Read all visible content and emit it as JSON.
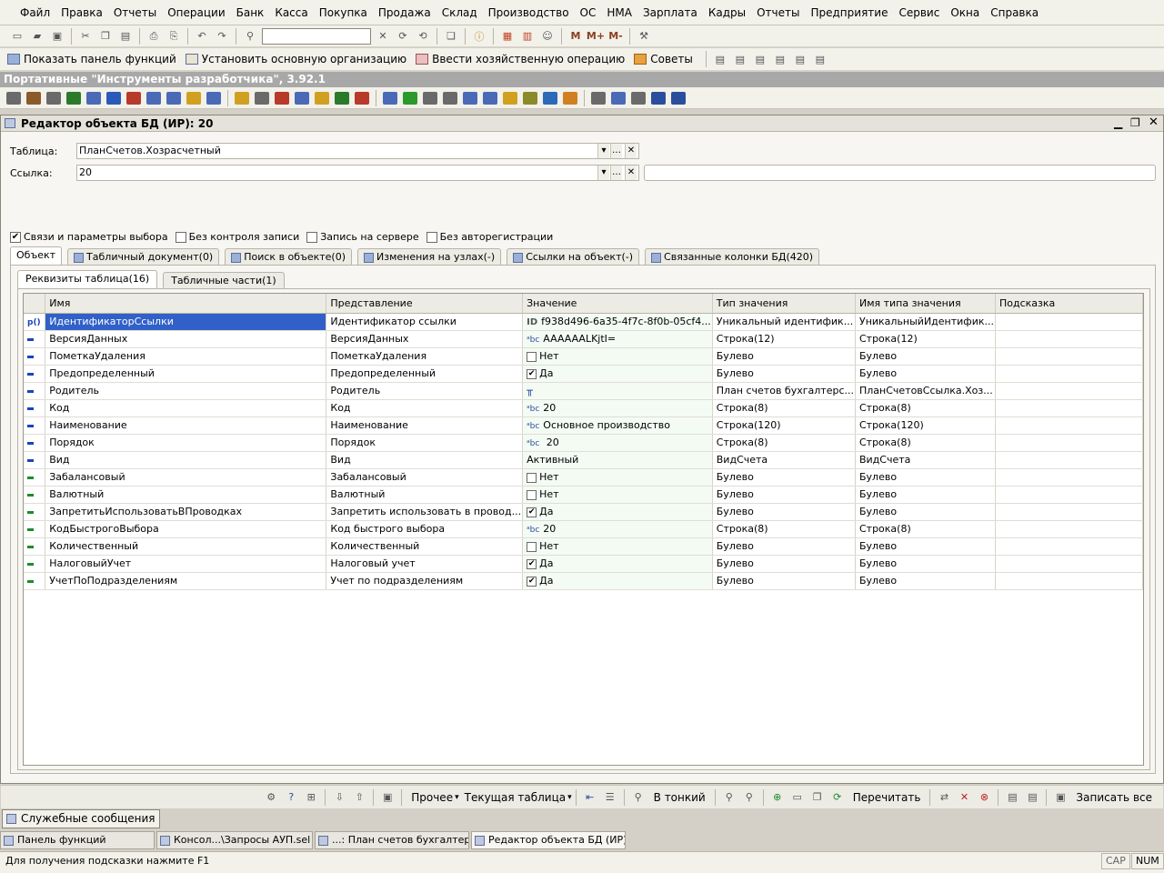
{
  "menu": [
    "Файл",
    "Правка",
    "Отчеты",
    "Операции",
    "Банк",
    "Касса",
    "Покупка",
    "Продажа",
    "Склад",
    "Производство",
    "ОС",
    "НМА",
    "Зарплата",
    "Кадры",
    "Отчеты",
    "Предприятие",
    "Сервис",
    "Окна",
    "Справка"
  ],
  "toolbar2": {
    "show_panel": "Показать панель функций",
    "set_org": "Установить основную организацию",
    "enter_op": "Ввести хозяйственную операцию",
    "tips": "Советы"
  },
  "portable_bar": "Портативные \"Инструменты разработчика\", 3.92.1",
  "window": {
    "title": "Редактор объекта БД (ИР): 20",
    "table_label": "Таблица:",
    "table_value": "ПланСчетов.Хозрасчетный",
    "link_label": "Ссылка:",
    "link_value": "20",
    "checks": [
      {
        "label": "Связи и параметры выбора",
        "checked": true
      },
      {
        "label": "Без контроля записи",
        "checked": false
      },
      {
        "label": "Запись на сервере",
        "checked": false
      },
      {
        "label": "Без авторегистрации",
        "checked": false
      }
    ],
    "tabs": [
      "Объект",
      "Табличный документ(0)",
      "Поиск в объекте(0)",
      "Изменения на узлах(-)",
      "Ссылки на объект(-)",
      "Связанные колонки БД(420)"
    ],
    "subtabs": [
      "Реквизиты таблица(16)",
      "Табличные части(1)"
    ]
  },
  "grid": {
    "columns": [
      "Имя",
      "Представление",
      "Значение",
      "Тип значения",
      "Имя типа значения",
      "Подсказка"
    ],
    "rows": [
      {
        "mark": "p()",
        "name": "ИдентификаторСсылки",
        "pres": "Идентификатор ссылки",
        "icon": "ID",
        "value": "f938d496-6a35-4f7c-8f0b-05cf4...",
        "type": "Уникальный идентифик...",
        "tname": "УникальныйИдентифик...",
        "hint": ""
      },
      {
        "mark": "blue",
        "name": "ВерсияДанных",
        "pres": "ВерсияДанных",
        "icon": "abc",
        "value": "AAAAAALKjtI=",
        "type": "Строка(12)",
        "tname": "Строка(12)",
        "hint": ""
      },
      {
        "mark": "blue",
        "name": "ПометкаУдаления",
        "pres": "ПометкаУдаления",
        "icon": "chk",
        "value": "Нет",
        "type": "Булево",
        "tname": "Булево",
        "hint": ""
      },
      {
        "mark": "blue",
        "name": "Предопределенный",
        "pres": "Предопределенный",
        "icon": "chk-on",
        "value": "Да",
        "type": "Булево",
        "tname": "Булево",
        "hint": ""
      },
      {
        "mark": "blue",
        "name": "Родитель",
        "pres": "Родитель",
        "icon": "ref",
        "value": "",
        "type": "План счетов бухгалтерс...",
        "tname": "ПланСчетовСсылка.Хоз...",
        "hint": ""
      },
      {
        "mark": "blue",
        "name": "Код",
        "pres": "Код",
        "icon": "abc",
        "value": "20",
        "type": "Строка(8)",
        "tname": "Строка(8)",
        "hint": ""
      },
      {
        "mark": "blue",
        "name": "Наименование",
        "pres": "Наименование",
        "icon": "abc",
        "value": "Основное производство",
        "type": "Строка(120)",
        "tname": "Строка(120)",
        "hint": ""
      },
      {
        "mark": "blue",
        "name": "Порядок",
        "pres": "Порядок",
        "icon": "abc",
        "value": " 20",
        "type": "Строка(8)",
        "tname": "Строка(8)",
        "hint": ""
      },
      {
        "mark": "blue",
        "name": "Вид",
        "pres": "Вид",
        "icon": "",
        "value": "Активный",
        "type": "ВидСчета",
        "tname": "ВидСчета",
        "hint": ""
      },
      {
        "mark": "green",
        "name": "Забалансовый",
        "pres": "Забалансовый",
        "icon": "chk",
        "value": "Нет",
        "type": "Булево",
        "tname": "Булево",
        "hint": ""
      },
      {
        "mark": "green",
        "name": "Валютный",
        "pres": "Валютный",
        "icon": "chk",
        "value": "Нет",
        "type": "Булево",
        "tname": "Булево",
        "hint": ""
      },
      {
        "mark": "green",
        "name": "ЗапретитьИспользоватьВПроводках",
        "pres": "Запретить использовать в провод...",
        "icon": "chk-on",
        "value": "Да",
        "type": "Булево",
        "tname": "Булево",
        "hint": ""
      },
      {
        "mark": "green",
        "name": "КодБыстрогоВыбора",
        "pres": "Код быстрого выбора",
        "icon": "abc",
        "value": "20",
        "type": "Строка(8)",
        "tname": "Строка(8)",
        "hint": ""
      },
      {
        "mark": "green",
        "name": "Количественный",
        "pres": "Количественный",
        "icon": "chk",
        "value": "Нет",
        "type": "Булево",
        "tname": "Булево",
        "hint": ""
      },
      {
        "mark": "green",
        "name": "НалоговыйУчет",
        "pres": "Налоговый учет",
        "icon": "chk-on",
        "value": "Да",
        "type": "Булево",
        "tname": "Булево",
        "hint": ""
      },
      {
        "mark": "green",
        "name": "УчетПоПодразделениям",
        "pres": "Учет по подразделениям",
        "icon": "chk-on",
        "value": "Да",
        "type": "Булево",
        "tname": "Булево",
        "hint": ""
      }
    ]
  },
  "bottom_toolbar": {
    "other": "Прочее",
    "current_table": "Текущая таблица",
    "to_thin": "В тонкий",
    "reread": "Перечитать",
    "write_all": "Записать все"
  },
  "messages_button": "Служебные сообщения",
  "taskbar": [
    "Панель функций",
    "Консол...\\Запросы АУП.sel *",
    "...: План счетов бухгалтерс...",
    "Редактор объекта БД (ИР):..."
  ],
  "status": {
    "hint": "Для получения подсказки нажмите F1",
    "cap": "CAP",
    "num": "NUM"
  }
}
